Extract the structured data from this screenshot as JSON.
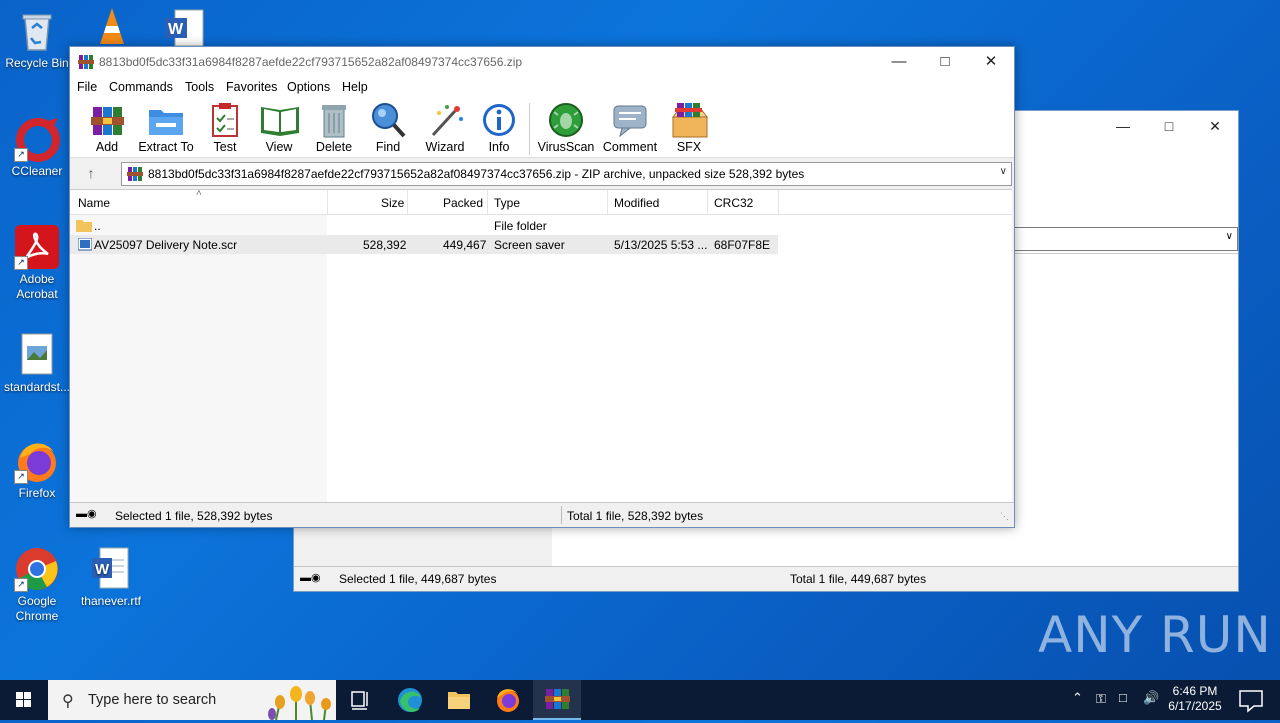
{
  "desktop": {
    "icons": [
      {
        "label": "Recycle Bin"
      },
      {
        "label": "CCleaner"
      },
      {
        "label": "Adobe Acrobat"
      },
      {
        "label": "standardst..."
      },
      {
        "label": "Firefox"
      },
      {
        "label": "Google Chrome"
      },
      {
        "label": "thanever.rtf"
      }
    ]
  },
  "background_window": {
    "status_selected": "Selected 1 file, 449,687 bytes",
    "status_total": "Total 1 file, 449,687 bytes"
  },
  "winrar": {
    "title": "8813bd0f5dc33f31a6984f8287aefde22cf793715652a82af08497374cc37656.zip",
    "menu": [
      "File",
      "Commands",
      "Tools",
      "Favorites",
      "Options",
      "Help"
    ],
    "toolbar": [
      "Add",
      "Extract To",
      "Test",
      "View",
      "Delete",
      "Find",
      "Wizard",
      "Info",
      "VirusScan",
      "Comment",
      "SFX"
    ],
    "path": "8813bd0f5dc33f31a6984f8287aefde22cf793715652a82af08497374cc37656.zip - ZIP archive, unpacked size 528,392 bytes",
    "columns": [
      "Name",
      "Size",
      "Packed",
      "Type",
      "Modified",
      "CRC32"
    ],
    "rows": [
      {
        "name": "..",
        "size": "",
        "packed": "",
        "type": "File folder",
        "modified": "",
        "crc": ""
      },
      {
        "name": "AV25097 Delivery Note.scr",
        "size": "528,392",
        "packed": "449,467",
        "type": "Screen saver",
        "modified": "5/13/2025 5:53 ...",
        "crc": "68F07F8E"
      }
    ],
    "status_selected": "Selected 1 file, 528,392 bytes",
    "status_total": "Total 1 file, 528,392 bytes"
  },
  "taskbar": {
    "search_placeholder": "Type here to search",
    "time": "6:46 PM",
    "date": "6/17/2025"
  },
  "watermark": "ANY RUN",
  "colors": {
    "desktop": "#0a63c9",
    "taskbar": "#0b1b35",
    "selection": "#eaeaea"
  }
}
